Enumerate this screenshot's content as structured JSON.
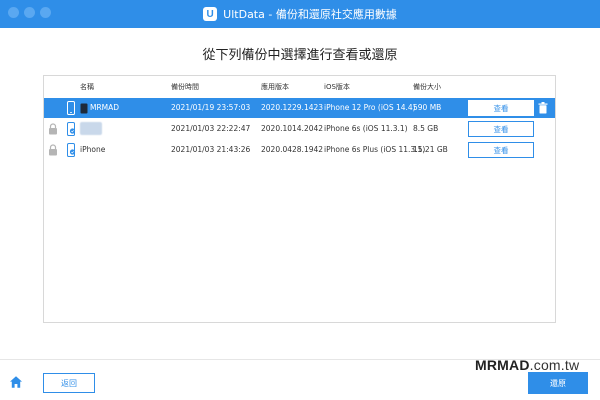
{
  "window": {
    "title": "UltData - 備份和還原社交應用數據",
    "logo_letter": "U"
  },
  "heading": "從下列備份中選擇進行查看或還原",
  "table": {
    "columns": [
      "名稱",
      "備份時間",
      "應用版本",
      "iOS版本",
      "備份大小"
    ],
    "rows": [
      {
        "name": "MRMAD",
        "time": "2021/01/19 23:57:03",
        "app_version": "2020.1229.1423",
        "ios_version": "iPhone 12 Pro  (iOS 14.4)",
        "size": "590 MB",
        "action": "查看",
        "selected": true,
        "locked": false,
        "name_blurred": false
      },
      {
        "name": "",
        "time": "2021/01/03 22:22:47",
        "app_version": "2020.1014.2042",
        "ios_version": "iPhone 6s (iOS 11.3.1)",
        "size": "8.5 GB",
        "action": "查看",
        "selected": false,
        "locked": true,
        "name_blurred": true
      },
      {
        "name": "iPhone",
        "time": "2021/01/03 21:43:26",
        "app_version": "2020.0428.1942",
        "ios_version": "iPhone 6s Plus (iOS 11.3.1)",
        "size": "15.21 GB",
        "action": "查看",
        "selected": false,
        "locked": true,
        "name_blurred": false
      }
    ]
  },
  "footer": {
    "back_label": "返回",
    "restore_label": "還原",
    "watermark_strong": "MRMAD",
    "watermark_light": ".com.tw"
  },
  "colors": {
    "accent": "#2f8ee8",
    "selected_row": "#2f8ee8"
  }
}
